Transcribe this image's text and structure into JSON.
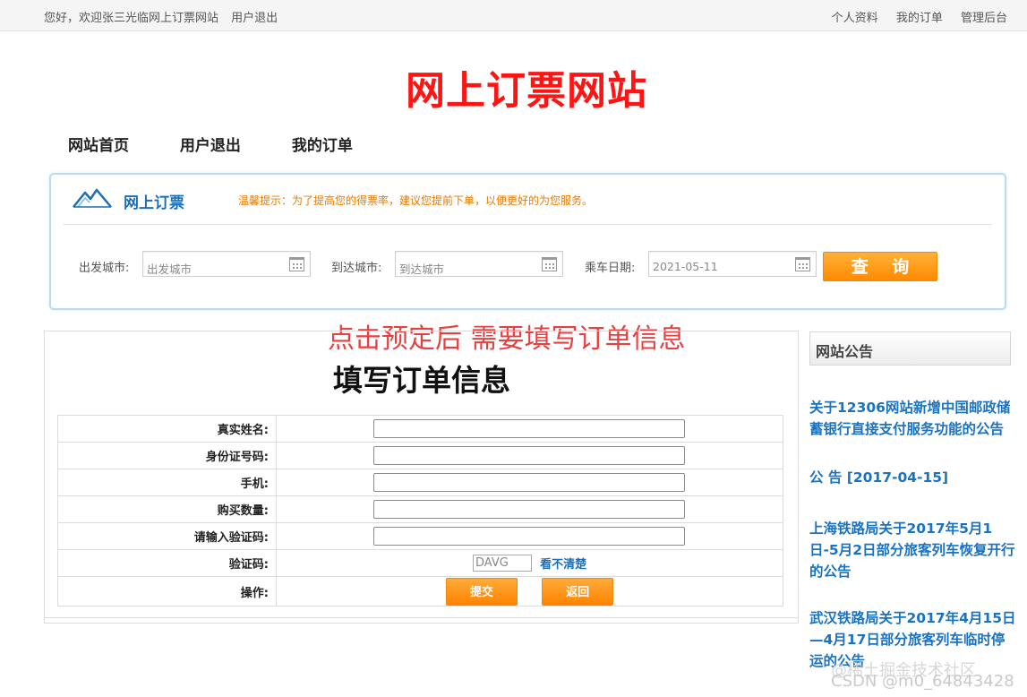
{
  "topbar": {
    "greeting": "您好，欢迎张三光临网上订票网站",
    "logout": "用户退出",
    "links": [
      "个人资料",
      "我的订单",
      "管理后台"
    ]
  },
  "site_title": "网上订票网站",
  "nav": [
    "网站首页",
    "用户退出",
    "我的订单"
  ],
  "search": {
    "label": "网上订票",
    "tip": "温馨提示：为了提高您的得票率，建议您提前下单，以便更好的为您服务。",
    "from_label": "出发城市:",
    "from_placeholder": "出发城市",
    "to_label": "到达城市:",
    "to_placeholder": "到达城市",
    "date_label": "乘车日期:",
    "date_value": "2021-05-11",
    "query_button": "查 询"
  },
  "annotation": "点击预定后 需要填写订单信息",
  "order": {
    "title": "填写订单信息",
    "fields": [
      "真实姓名:",
      "身份证号码:",
      "手机:",
      "购买数量:",
      "请输入验证码:"
    ],
    "captcha_label": "验证码:",
    "captcha_value": "DAVG",
    "captcha_refresh": "看不清楚",
    "action_label": "操作:",
    "submit": "提交",
    "back": "返回"
  },
  "notices": {
    "title": "网站公告",
    "items": [
      "关于12306网站新增中国邮政储蓄银行直接支付服务功能的公告",
      "公 告 [2017-04-15]",
      "上海铁路局关于2017年5月1日-5月2日部分旅客列车恢复开行的公告",
      "武汉铁路局关于2017年4月15日—4月17日部分旅客列车临时停运的公告"
    ]
  },
  "watermark": {
    "line1": "@稀土掘金技术社区",
    "line2": "CSDN @m0_64843428"
  },
  "colors": {
    "title_red": "#ff1414",
    "accent_blue": "#1a6fb8",
    "button_orange": "#ff8a00",
    "tip_orange": "#e77b00"
  }
}
